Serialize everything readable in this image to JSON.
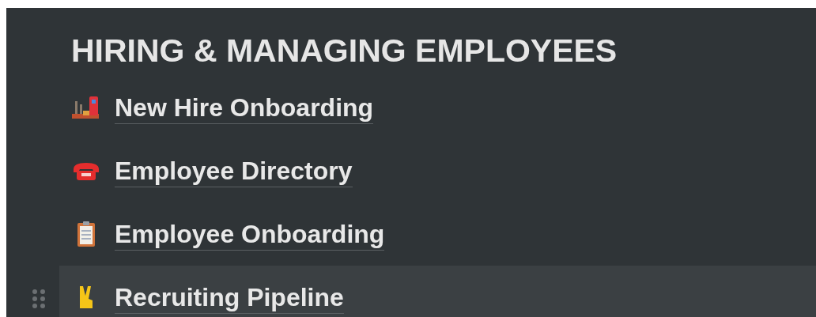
{
  "heading": "HIRING & MANAGING EMPLOYEES",
  "pages": [
    {
      "title": "New Hire Onboarding",
      "hovered": false
    },
    {
      "title": "Employee Directory",
      "hovered": false
    },
    {
      "title": "Employee Onboarding",
      "hovered": false
    },
    {
      "title": "Recruiting Pipeline",
      "hovered": true
    }
  ]
}
